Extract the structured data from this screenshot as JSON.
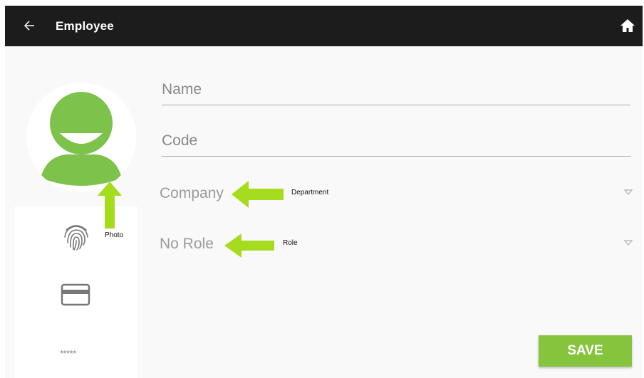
{
  "appbar": {
    "title": "Employee",
    "back_icon": "arrow-left-icon",
    "home_icon": "home-icon",
    "background": "#1c1c1c"
  },
  "form": {
    "name_placeholder": "Name",
    "name_value": "",
    "code_placeholder": "Code",
    "code_value": "",
    "company_value": "Company",
    "role_value": "No Role"
  },
  "sidebar": {
    "photo_icon": "user-avatar-icon",
    "fingerprint_icon": "fingerprint-icon",
    "card_icon": "credit-card-icon",
    "pin_text": "*****"
  },
  "annotations": {
    "photo": "Photo",
    "department": "Department",
    "role": "Role"
  },
  "actions": {
    "save_label": "SAVE"
  },
  "colors": {
    "accent": "#86c43e",
    "avatar": "#7dc24a",
    "annotation_arrow": "#a6dc1e"
  }
}
